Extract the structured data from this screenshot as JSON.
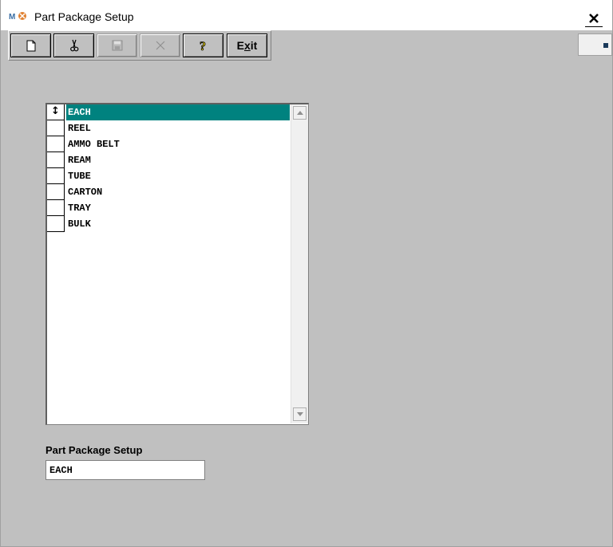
{
  "window": {
    "title": "Part Package Setup",
    "close_label": "✕"
  },
  "toolbar": {
    "buttons": [
      {
        "name": "new-button",
        "icon": "new-document-icon",
        "enabled": true
      },
      {
        "name": "cut-button",
        "icon": "scissors-icon",
        "enabled": true
      },
      {
        "name": "save-button",
        "icon": "save-icon",
        "enabled": false
      },
      {
        "name": "delete-button",
        "icon": "delete-x-icon",
        "enabled": false
      },
      {
        "name": "help-button",
        "icon": "question-mark-icon",
        "enabled": true
      },
      {
        "name": "exit-button",
        "label": "Exit",
        "mnemonic": "x",
        "enabled": true
      }
    ],
    "exit_label_pre": "E",
    "exit_label_mnemonic": "x",
    "exit_label_post": "it"
  },
  "grid": {
    "current_row_indicator": "↕",
    "rows": [
      "EACH",
      "REEL",
      "AMMO BELT",
      "REAM",
      "TUBE",
      "CARTON",
      "TRAY",
      "BULK"
    ],
    "selected_index": 0
  },
  "form": {
    "label": "Part Package Setup",
    "value": "EACH"
  },
  "colors": {
    "selection": "#00827f",
    "background": "#c0c0c0"
  }
}
